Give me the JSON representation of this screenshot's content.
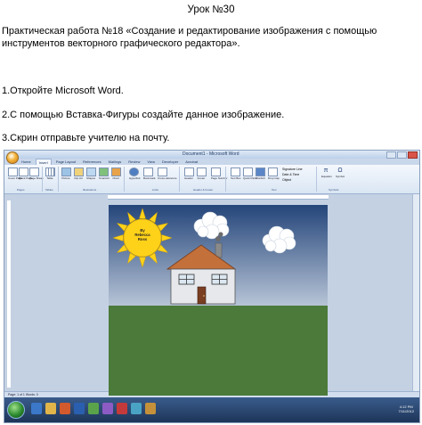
{
  "lesson_title": "Урок №30",
  "assignment": "Практическая работа №18 «Создание и редактирование изображения с помощью инструментов векторного графического редактора».",
  "steps": [
    "1.Откройте Microsoft Word.",
    "2.С помощью Вставка-Фигуры создайте данное изображение.",
    "3.Скрин отправьте учителю на почту."
  ],
  "word": {
    "window_title": "Document1 - Microsoft Word",
    "tabs": [
      "Home",
      "Insert",
      "Page Layout",
      "References",
      "Mailings",
      "Review",
      "View",
      "Developer",
      "Acrobat"
    ],
    "active_tab": "Insert",
    "ribbon_buttons": [
      "Cover Page",
      "Blank Page",
      "Page Break",
      "Table",
      "Picture",
      "Clip Art",
      "Shapes",
      "SmartArt",
      "Chart",
      "Hyperlink",
      "Bookmark",
      "Cross-reference",
      "Header",
      "Footer",
      "Page Number",
      "Text Box",
      "Quick Parts",
      "WordArt",
      "Drop Cap",
      "Equation",
      "Symbol"
    ],
    "ribbon_groups": [
      "Pages",
      "Tables",
      "Illustrations",
      "Links",
      "Header & Footer",
      "Text",
      "Symbols"
    ],
    "text_side_items": [
      "Signature Line",
      "Date & Time",
      "Object"
    ],
    "status_text": "Page: 1 of 1   Words: 0",
    "clock_time": "4:12 PM",
    "clock_date": "7/11/2012"
  },
  "drawing": {
    "sun_label": "By Rebecca Ross",
    "colors": {
      "sky_top": "#24457a",
      "sky_bottom": "#b7c4d6",
      "grass": "#4b7a3a",
      "sun": "#ffd21a",
      "roof": "#c4703a",
      "wall": "#e6e8ec",
      "door": "#7a3e22"
    }
  }
}
